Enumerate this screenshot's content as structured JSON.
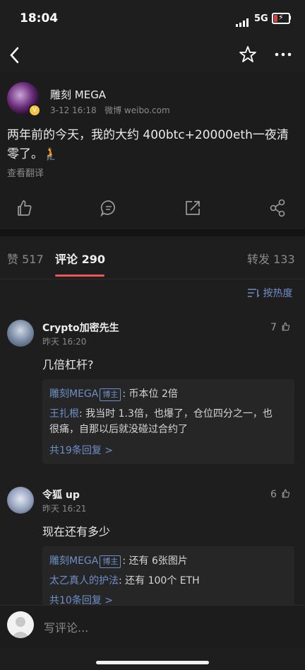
{
  "status": {
    "time": "18:04",
    "network": "5G"
  },
  "post": {
    "author": "雕刻 MEGA",
    "date": "3-12 16:18",
    "source": "微博 weibo.com",
    "text": "两年前的今天，我的大约 400btc+20000eth一夜清零了。🧎",
    "translate": "查看翻译"
  },
  "tabs": {
    "likes": "赞 517",
    "comments": "评论 290",
    "reposts": "转发 133"
  },
  "sort_label": "按热度",
  "comments": [
    {
      "name": "Crypto加密先生",
      "time": "昨天 16:20",
      "likes": "7",
      "text": "几倍杠杆?",
      "replies": [
        {
          "name": "雕刻MEGA",
          "tag": "博主",
          "text": ": 币本位 2倍"
        },
        {
          "name": "王扎根",
          "text": ": 我当时 1.3倍，也爆了，仓位四分之一，也很痛，自那以后就没碰过合约了"
        }
      ],
      "more": "共19条回复 >"
    },
    {
      "name": "令狐 up",
      "time": "昨天 16:21",
      "likes": "6",
      "text": "现在还有多少",
      "replies": [
        {
          "name": "雕刻MEGA",
          "tag": "博主",
          "text": ": 还有 6张图片"
        },
        {
          "name": "太乙真人的护法",
          "text": ": 还有 100个 ETH"
        }
      ],
      "more": "共10条回复 >"
    }
  ],
  "composer": {
    "placeholder": "写评论..."
  }
}
